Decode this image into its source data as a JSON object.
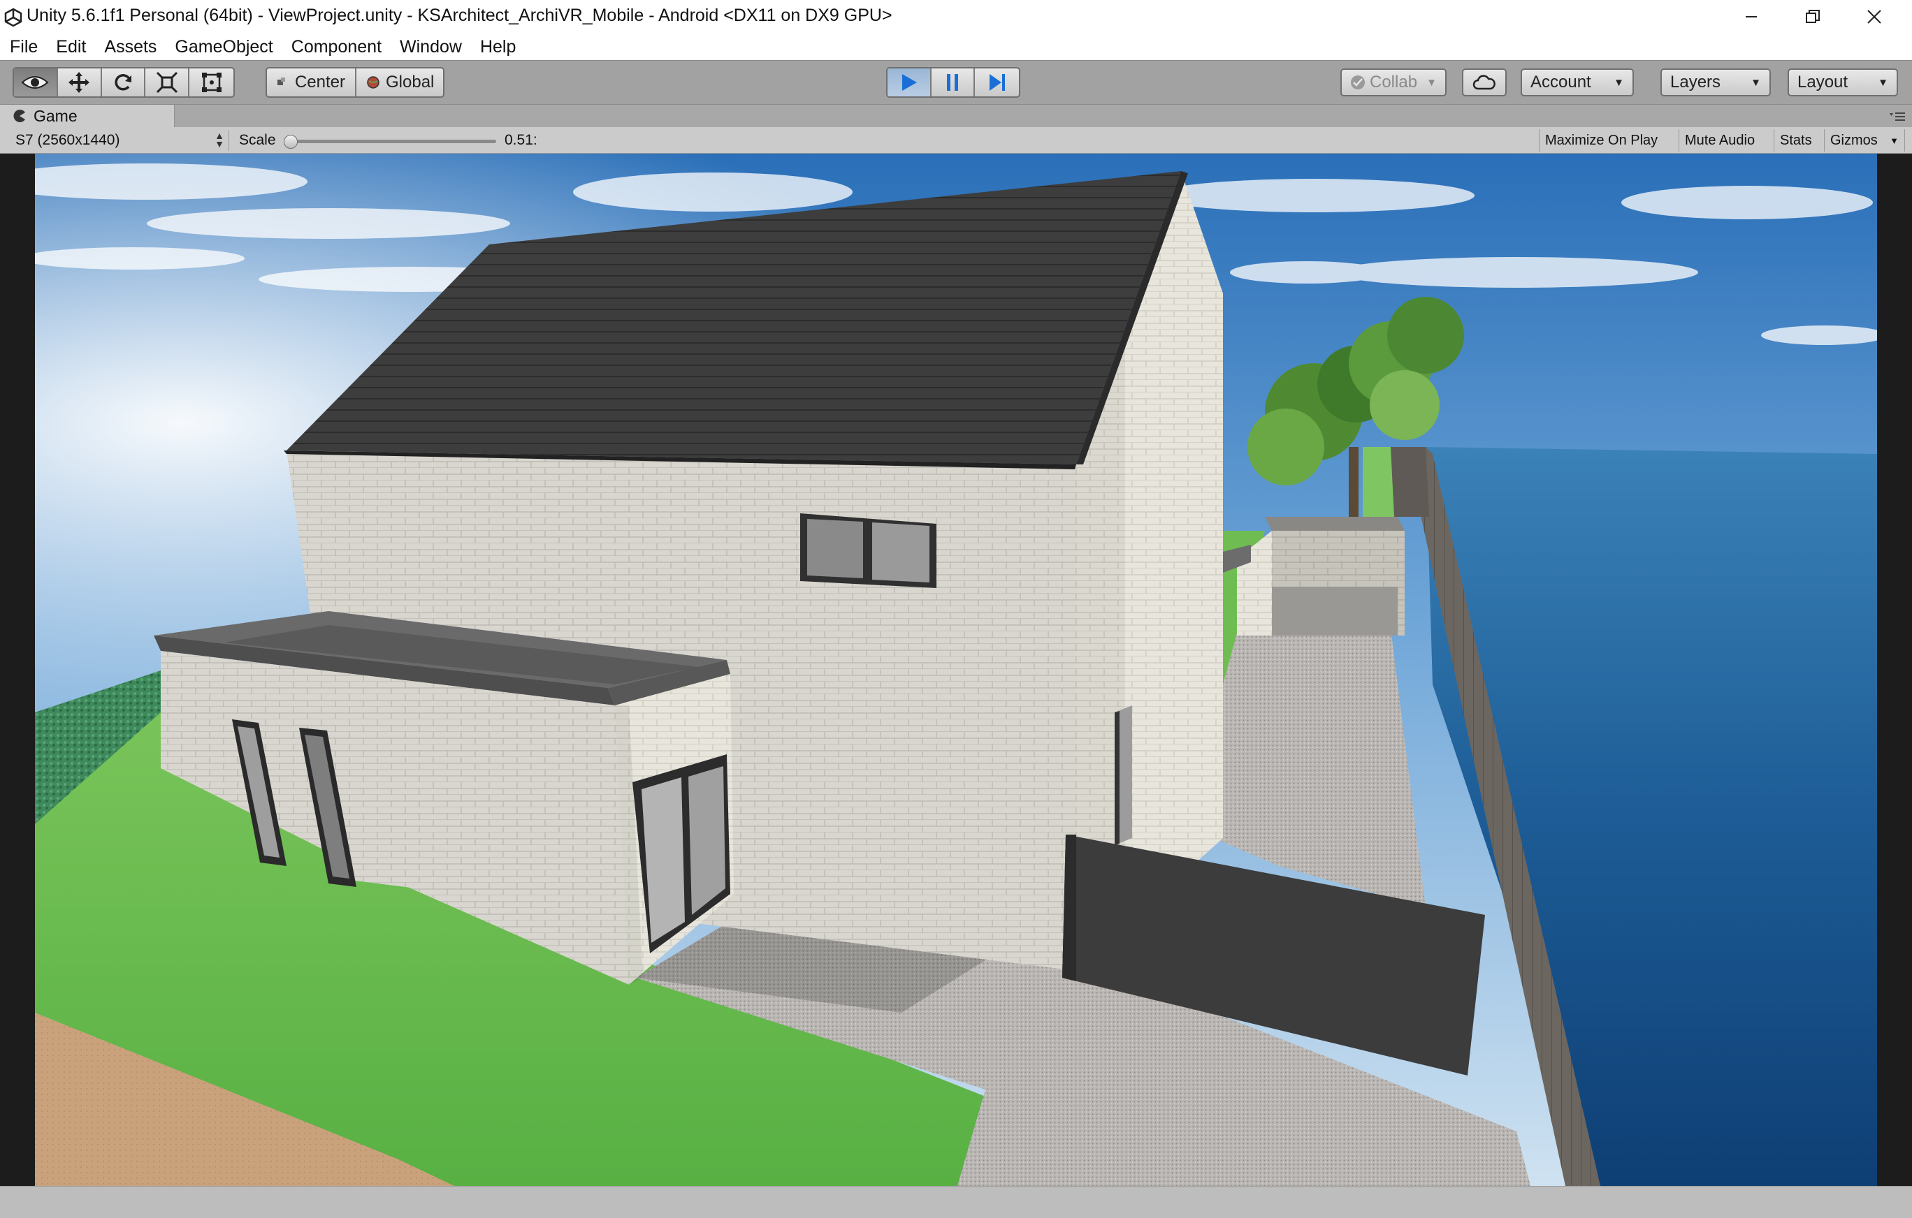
{
  "window": {
    "title": "Unity 5.6.1f1 Personal (64bit) - ViewProject.unity - KSArchitect_ArchiVR_Mobile - Android <DX11 on DX9 GPU>"
  },
  "menu": {
    "items": [
      "File",
      "Edit",
      "Assets",
      "GameObject",
      "Component",
      "Window",
      "Help"
    ]
  },
  "toolbar": {
    "tools": [
      "view-tool",
      "move-tool",
      "rotate-tool",
      "scale-tool",
      "rect-tool"
    ],
    "pivot_label": "Center",
    "space_label": "Global",
    "collab_label": "Collab",
    "account_label": "Account",
    "layers_label": "Layers",
    "layout_label": "Layout"
  },
  "game_view": {
    "tab_label": "Game",
    "resolution": "S7 (2560x1440)",
    "scale_label": "Scale",
    "scale_value": "0.51:",
    "maximize_label": "Maximize On Play",
    "mute_label": "Mute Audio",
    "stats_label": "Stats",
    "gizmos_label": "Gizmos"
  },
  "colors": {
    "play_active": "#1a6fd6",
    "toolbar_bg": "#a2a2a2",
    "panel_bg": "#cbcbcb"
  }
}
